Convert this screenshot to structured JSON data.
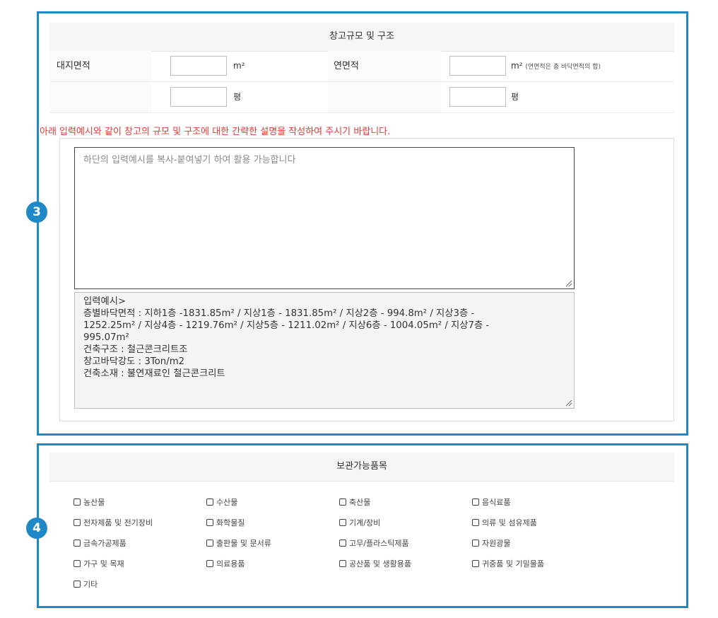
{
  "section3": {
    "badge": "3",
    "title": "창고규모 및 구조",
    "row1": {
      "label_left": "대지면적",
      "unit_left": "m²",
      "label_right": "연면적",
      "unit_right": "m²",
      "unit_right_note": "(연면적은 총 바닥면적의 합)"
    },
    "row2": {
      "unit_left": "평",
      "unit_right": "평"
    },
    "notice": "아래 입력예시와 같이 창고의 규모 및 구조에 대한 간략한 설명을 작성하여 주시기 바랍니다.",
    "textarea_placeholder": "하단의 입력예시를 복사-붙여넣기 하여 활용 가능합니다",
    "example_text": "입력예시>\n층별바닥면적 : 지하1층 -1831.85m² / 지상1층 - 1831.85m² / 지상2층 - 994.8m² / 지상3층 -\n1252.25m² / 지상4층 - 1219.76m² / 지상5층 - 1211.02m² / 지상6층 - 1004.05m² / 지상7층 -\n995.07m²\n건축구조 : 철근콘크리트조\n창고바닥강도 : 3Ton/m2\n건축소재 : 불연재료인 철근콘크리트"
  },
  "section4": {
    "badge": "4",
    "title": "보관가능품목",
    "items": [
      [
        "농산물",
        "수산물",
        "축산물",
        "음식료품"
      ],
      [
        "전자제품 및 전기장비",
        "화학물질",
        "기계/장비",
        "의류 및 섬유제품"
      ],
      [
        "금속가공제품",
        "출판물 및 문서류",
        "고무/플라스틱제품",
        "자원광물"
      ],
      [
        "가구 및 목재",
        "의료용품",
        "공산품 및 생활용품",
        "귀중품 및 기밀물품"
      ],
      [
        "기타"
      ]
    ]
  },
  "colors": {
    "accent": "#1e88c8",
    "notice": "#e53935"
  }
}
